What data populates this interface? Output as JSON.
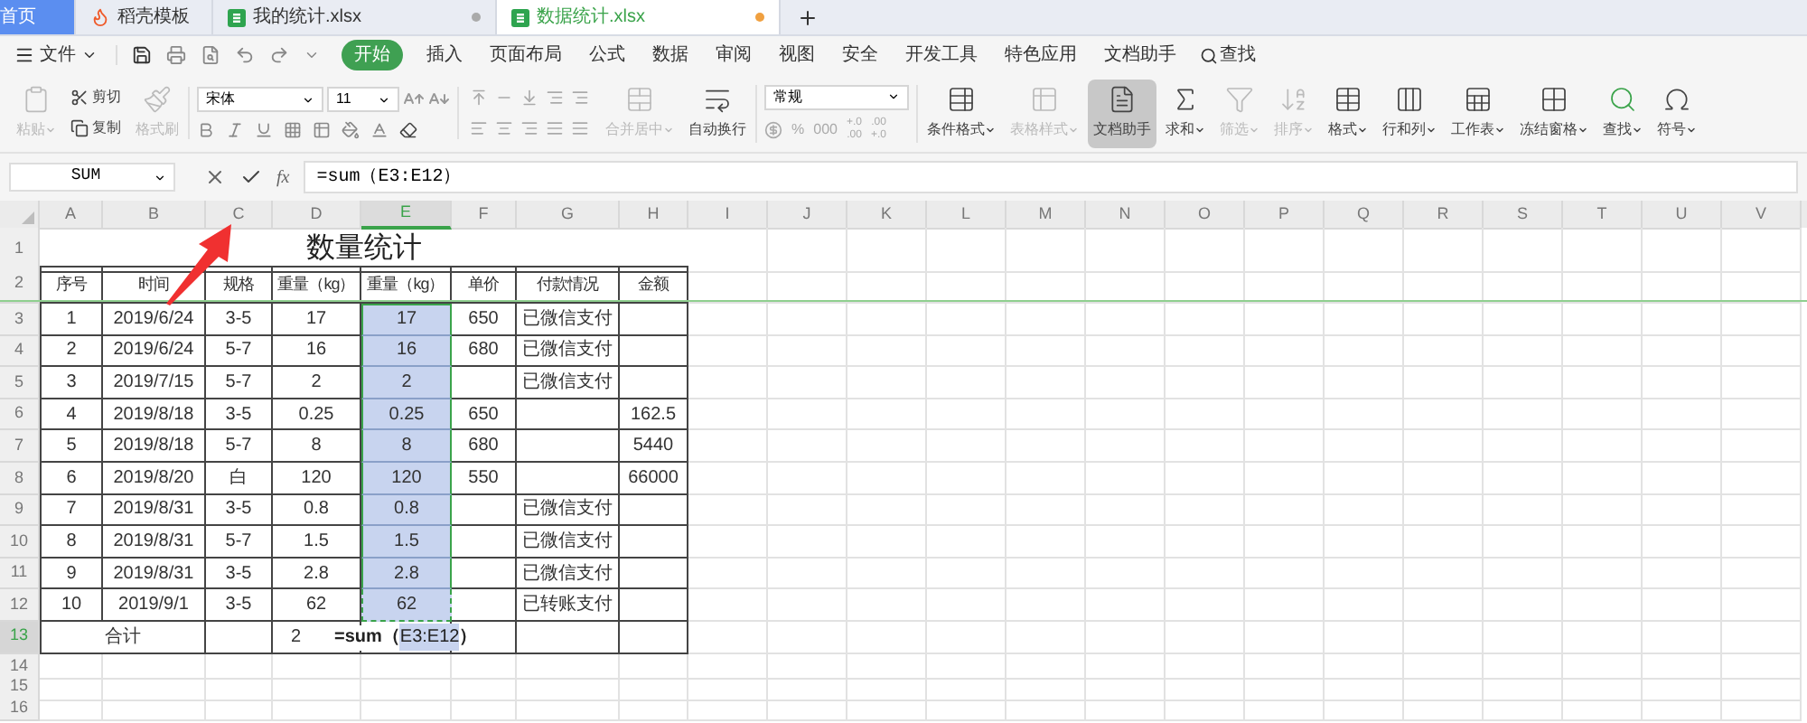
{
  "tabs": [
    {
      "kind": "home",
      "label": "首页",
      "selected": false,
      "unsaved": false
    },
    {
      "kind": "template",
      "label": "稻壳模板",
      "selected": false,
      "unsaved": false
    },
    {
      "kind": "sheet",
      "label": "我的统计.xlsx",
      "selected": false,
      "unsaved": true
    },
    {
      "kind": "sheet",
      "label": "数据统计.xlsx",
      "selected": true,
      "unsaved": true
    }
  ],
  "menu": {
    "file": "文件",
    "tabs": [
      {
        "label": "开始",
        "selected": true
      },
      {
        "label": "插入",
        "selected": false
      },
      {
        "label": "页面布局",
        "selected": false
      },
      {
        "label": "公式",
        "selected": false
      },
      {
        "label": "数据",
        "selected": false
      },
      {
        "label": "审阅",
        "selected": false
      },
      {
        "label": "视图",
        "selected": false
      },
      {
        "label": "安全",
        "selected": false
      },
      {
        "label": "开发工具",
        "selected": false
      },
      {
        "label": "特色应用",
        "selected": false
      },
      {
        "label": "文档助手",
        "selected": false
      }
    ],
    "search": "查找"
  },
  "ribbon": [
    {
      "kind": "large",
      "label": "粘贴",
      "disabled": true,
      "dropdown": true,
      "pressed": false
    },
    {
      "kind": "pair",
      "items": [
        {
          "label": "剪切",
          "disabled": false
        },
        {
          "label": "复制",
          "disabled": false
        }
      ]
    },
    {
      "kind": "large",
      "label": "格式刷",
      "disabled": true,
      "dropdown": false,
      "pressed": false
    },
    {
      "kind": "font",
      "font": "宋体",
      "size": "11"
    },
    {
      "kind": "align"
    },
    {
      "kind": "large",
      "label": "合并居中",
      "disabled": true,
      "dropdown": true,
      "pressed": false
    },
    {
      "kind": "large",
      "label": "自动换行",
      "disabled": false,
      "dropdown": false,
      "pressed": false
    },
    {
      "kind": "number",
      "format": "常规",
      "symbols": [
        "%",
        "000"
      ],
      "decimals": [
        {
          "top": "+.0",
          "bottom": ".00"
        },
        {
          "top": ".00",
          "bottom": "+.0"
        }
      ]
    },
    {
      "kind": "large",
      "label": "条件格式",
      "disabled": false,
      "dropdown": true,
      "pressed": false
    },
    {
      "kind": "large",
      "label": "表格样式",
      "disabled": true,
      "dropdown": true,
      "pressed": false
    },
    {
      "kind": "large",
      "label": "文档助手",
      "disabled": false,
      "dropdown": false,
      "pressed": true
    },
    {
      "kind": "large",
      "label": "求和",
      "disabled": false,
      "dropdown": true,
      "pressed": false
    },
    {
      "kind": "large",
      "label": "筛选",
      "disabled": true,
      "dropdown": true,
      "pressed": false
    },
    {
      "kind": "large",
      "label": "排序",
      "disabled": true,
      "dropdown": true,
      "pressed": false
    },
    {
      "kind": "large",
      "label": "格式",
      "disabled": false,
      "dropdown": true,
      "pressed": false
    },
    {
      "kind": "large",
      "label": "行和列",
      "disabled": false,
      "dropdown": true,
      "pressed": false
    },
    {
      "kind": "large",
      "label": "工作表",
      "disabled": false,
      "dropdown": true,
      "pressed": false
    },
    {
      "kind": "large",
      "label": "冻结窗格",
      "disabled": false,
      "dropdown": true,
      "pressed": false
    },
    {
      "kind": "large",
      "label": "查找",
      "disabled": false,
      "dropdown": true,
      "pressed": false
    },
    {
      "kind": "large",
      "label": "符号",
      "disabled": false,
      "dropdown": true,
      "pressed": false
    }
  ],
  "formula_bar": {
    "name_box": "SUM",
    "function_label": "fx",
    "value": "=sum（E3:E12）"
  },
  "columns": [
    {
      "label": "A",
      "selected": false
    },
    {
      "label": "B",
      "selected": false
    },
    {
      "label": "C",
      "selected": false
    },
    {
      "label": "D",
      "selected": false
    },
    {
      "label": "E",
      "selected": true
    },
    {
      "label": "F",
      "selected": false
    },
    {
      "label": "G",
      "selected": false
    },
    {
      "label": "H",
      "selected": false
    },
    {
      "label": "I",
      "selected": false
    },
    {
      "label": "J",
      "selected": false
    },
    {
      "label": "K",
      "selected": false
    },
    {
      "label": "L",
      "selected": false
    },
    {
      "label": "M",
      "selected": false
    },
    {
      "label": "N",
      "selected": false
    },
    {
      "label": "O",
      "selected": false
    },
    {
      "label": "P",
      "selected": false
    },
    {
      "label": "Q",
      "selected": false
    },
    {
      "label": "R",
      "selected": false
    },
    {
      "label": "S",
      "selected": false
    },
    {
      "label": "T",
      "selected": false
    },
    {
      "label": "U",
      "selected": false
    },
    {
      "label": "V",
      "selected": false
    }
  ],
  "rows": [
    {
      "kind": "title",
      "number": "1",
      "selected": false,
      "in_range": false,
      "title": "数量统计"
    },
    {
      "kind": "header",
      "number": "2",
      "selected": false,
      "in_range": false,
      "cells": {
        "A": "序号",
        "B": "时间",
        "C": "规格",
        "D": "重量（kg）",
        "E": "重量（kg）",
        "F": "单价",
        "G": "付款情况",
        "H": "金额"
      }
    },
    {
      "kind": "data",
      "number": "3",
      "selected": false,
      "in_range": true,
      "cells": {
        "A": "1",
        "B": "2019/6/24",
        "C": "3-5",
        "D": "17",
        "E": "17",
        "F": "650",
        "G": "已微信支付"
      }
    },
    {
      "kind": "data",
      "number": "4",
      "selected": false,
      "in_range": true,
      "cells": {
        "A": "2",
        "B": "2019/6/24",
        "C": "5-7",
        "D": "16",
        "E": "16",
        "F": "680",
        "G": "已微信支付"
      }
    },
    {
      "kind": "data",
      "number": "5",
      "selected": false,
      "in_range": true,
      "cells": {
        "A": "3",
        "B": "2019/7/15",
        "C": "5-7",
        "D": "2",
        "E": "2",
        "G": "已微信支付"
      }
    },
    {
      "kind": "data",
      "number": "6",
      "selected": false,
      "in_range": true,
      "cells": {
        "A": "4",
        "B": "2019/8/18",
        "C": "3-5",
        "D": "0.25",
        "E": "0.25",
        "F": "650",
        "H": "162.5"
      }
    },
    {
      "kind": "data",
      "number": "7",
      "selected": false,
      "in_range": true,
      "cells": {
        "A": "5",
        "B": "2019/8/18",
        "C": "5-7",
        "D": "8",
        "E": "8",
        "F": "680",
        "H": "5440"
      }
    },
    {
      "kind": "data",
      "number": "8",
      "selected": false,
      "in_range": true,
      "cells": {
        "A": "6",
        "B": "2019/8/20",
        "C": "白",
        "D": "120",
        "E": "120",
        "F": "550",
        "H": "66000"
      }
    },
    {
      "kind": "data",
      "number": "9",
      "selected": false,
      "in_range": true,
      "cells": {
        "A": "7",
        "B": "2019/8/31",
        "C": "3-5",
        "D": "0.8",
        "E": "0.8",
        "G": "已微信支付"
      }
    },
    {
      "kind": "data",
      "number": "10",
      "selected": false,
      "in_range": true,
      "cells": {
        "A": "8",
        "B": "2019/8/31",
        "C": "5-7",
        "D": "1.5",
        "E": "1.5",
        "G": "已微信支付"
      }
    },
    {
      "kind": "data",
      "number": "11",
      "selected": false,
      "in_range": true,
      "cells": {
        "A": "9",
        "B": "2019/8/31",
        "C": "3-5",
        "D": "2.8",
        "E": "2.8",
        "G": "已微信支付"
      }
    },
    {
      "kind": "data",
      "number": "12",
      "selected": false,
      "in_range": true,
      "cells": {
        "A": "10",
        "B": "2019/9/1",
        "C": "3-5",
        "D": "62",
        "E": "62",
        "G": "已转账支付"
      }
    },
    {
      "kind": "total",
      "number": "13",
      "selected": true,
      "in_range": false,
      "label": "合计",
      "cells": {
        "D": "2"
      },
      "editor": {
        "prefix": "=sum（",
        "ref": "E3:E12",
        "suffix": "）"
      }
    },
    {
      "kind": "empty",
      "number": "14",
      "selected": false,
      "in_range": false
    },
    {
      "kind": "empty",
      "number": "15",
      "selected": false,
      "in_range": false
    },
    {
      "kind": "empty",
      "number": "16",
      "selected": false,
      "in_range": false
    }
  ]
}
